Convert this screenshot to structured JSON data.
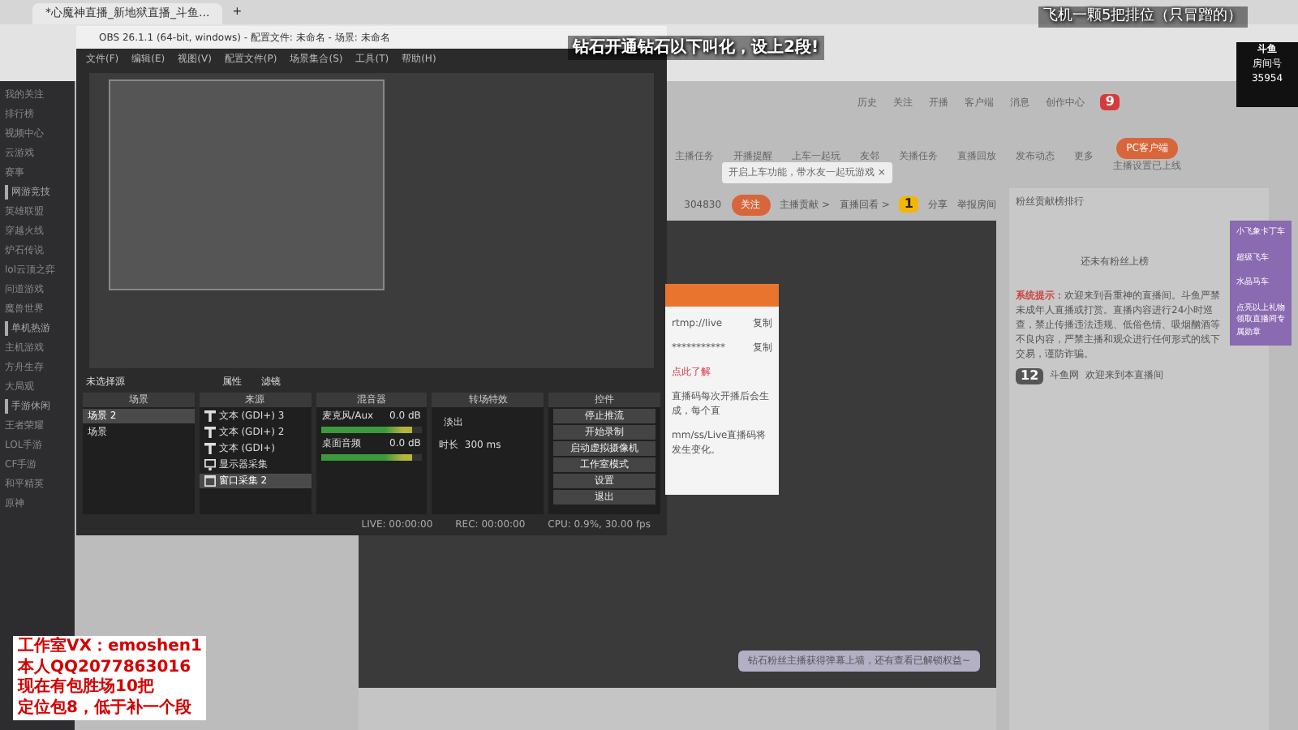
{
  "browser": {
    "tab_title": "*心魔神直播_新地狱直播_斗鱼...",
    "new_tab": "+"
  },
  "stream_overlay": {
    "line_1": "飞机一颗5把排位（只冒蹭的）",
    "line_2": "钻石开通钻石以下叫化，设上2段!"
  },
  "sidebar": {
    "items": [
      "我的关注",
      "排行榜",
      "视频中心",
      "云游戏",
      "赛事"
    ],
    "sections": [
      {
        "title": "网游竞技",
        "items": [
          "英雄联盟",
          "穿越火线",
          "炉石传说",
          "lol云顶之弈",
          "问道游戏",
          "魔兽世界"
        ]
      },
      {
        "title": "单机热游",
        "items": [
          "主机游戏",
          "方舟生存",
          "大局观"
        ]
      },
      {
        "title": "手游休闲",
        "items": [
          "王者荣耀",
          "LOL手游",
          "CF手游",
          "和平精英",
          "原神"
        ]
      }
    ]
  },
  "site_header": {
    "top_links": [
      "历史",
      "关注",
      "开播",
      "客户端",
      "消息",
      "创作中心"
    ],
    "badge": "9",
    "tools": [
      "主播任务",
      "开播提醒",
      "上车一起玩",
      "友邻",
      "关播任务",
      "直播回放",
      "发布动态",
      "更多"
    ],
    "pc_button": "PC客户端",
    "pc_note": "主播设置已上线",
    "tooltip": "开启上车功能，带水友一起玩游戏 ×",
    "follow_count": "304830",
    "follow_button": "关注",
    "rank_link": "主播贡献 >",
    "replay_link": "直播回看 >",
    "share": "分享",
    "report": "举报房间",
    "level": "1"
  },
  "chat": {
    "fan_rank": "粉丝贡献榜排行",
    "empty_note": "还未有粉丝上榜",
    "system_label": "系统提示：",
    "system_text": "欢迎来到吾重神的直播间。斗鱼严禁未成年人直播或打赏。直播内容进行24小时巡查，禁止传播违法违规、低俗色情、吸烟酗酒等不良内容，严禁主播和观众进行任何形式的线下交易，谨防诈骗。",
    "user_level": "12",
    "user_name": "斗鱼网",
    "welcome": "欢迎来到本直播间",
    "gift_panel": [
      "小飞象卡丁车",
      "超级飞车",
      "水晶马车"
    ],
    "gift_note": "点亮以上礼物领取直播间专属勋章"
  },
  "logo": {
    "name": "斗鱼",
    "label": "房间号",
    "room": "35954"
  },
  "obs": {
    "title": "OBS 26.1.1 (64-bit, windows) - 配置文件: 未命名 - 场景: 未命名",
    "menu": [
      "文件(F)",
      "编辑(E)",
      "视图(V)",
      "配置文件(P)",
      "场景集合(S)",
      "工具(T)",
      "帮助(H)"
    ],
    "no_source": "未选择源",
    "properties": "属性",
    "filters": "滤镜",
    "scenes": {
      "title": "场景",
      "items": [
        {
          "label": "场景 2",
          "selected": true
        },
        {
          "label": "场景",
          "selected": false
        }
      ]
    },
    "sources": {
      "title": "来源",
      "items": [
        {
          "label": "文本 (GDI+) 3",
          "kind": "text",
          "selected": false
        },
        {
          "label": "文本 (GDI+) 2",
          "kind": "text",
          "selected": false
        },
        {
          "label": "文本 (GDI+)",
          "kind": "text",
          "selected": false
        },
        {
          "label": "显示器采集",
          "kind": "display",
          "selected": false
        },
        {
          "label": "窗口采集 2",
          "kind": "window",
          "selected": true
        }
      ]
    },
    "mixer": {
      "title": "混音器",
      "channels": [
        {
          "name": "麦克风/Aux",
          "reading": "0.0 dB",
          "level": 0.9
        },
        {
          "name": "桌面音频",
          "reading": "0.0 dB",
          "level": 0.9
        }
      ]
    },
    "transitions": {
      "title": "转场特效",
      "effect": "淡出",
      "duration_label": "时长",
      "duration": "300 ms"
    },
    "controls": {
      "title": "控件",
      "buttons": [
        "停止推流",
        "开始录制",
        "启动虚拟摄像机",
        "工作室模式",
        "设置",
        "退出"
      ]
    },
    "status": {
      "live": "LIVE: 00:00:00",
      "rec": "REC: 00:00:00",
      "cpu": "CPU: 0.9%, 30.00 fps"
    }
  },
  "dialog": {
    "rows": [
      {
        "label": "rtmp://live",
        "action": "复制"
      },
      {
        "label": "***********",
        "action": "复制"
      }
    ],
    "link": "点此了解",
    "note": "直播码每次开播后会生成，每个直",
    "note_2": "mm/ss/Live直播码将发生变化。"
  },
  "notice": "钻石粉丝主播获得弹幕上墙，还有查看已解锁权益~",
  "promo": {
    "line_1": "工作室VX：emoshen1",
    "line_2": "本人QQ2077863016",
    "line_3": "现在有包胜场10把",
    "line_4": "定位包8，低于补一个段"
  }
}
